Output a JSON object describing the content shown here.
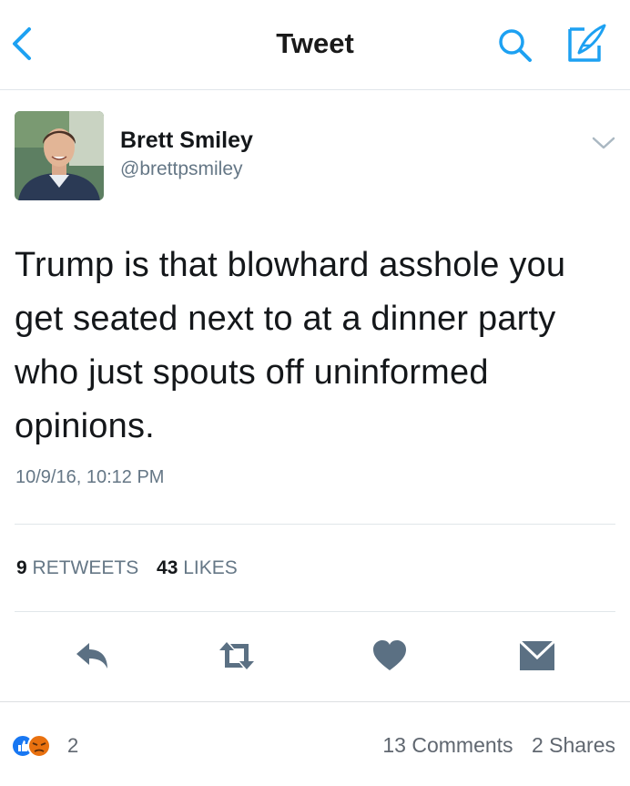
{
  "header": {
    "title": "Tweet"
  },
  "tweet": {
    "author_name": "Brett Smiley",
    "author_handle": "@brettpsmiley",
    "text": "Trump is that blowhard asshole you get seated next to at a dinner party who just spouts off uninformed opinions.",
    "timestamp": "10/9/16, 10:12 PM",
    "retweets_count": "9",
    "retweets_label": "RETWEETS",
    "likes_count": "43",
    "likes_label": "LIKES"
  },
  "colors": {
    "accent": "#1da1f2",
    "icon_gray": "#657786",
    "action_gray": "#5b7083"
  },
  "icons": [
    "back-icon",
    "search-icon",
    "compose-icon",
    "chevron-down-icon",
    "reply-icon",
    "retweet-icon",
    "like-icon",
    "message-icon",
    "like-reaction-icon",
    "angry-reaction-icon"
  ],
  "facebook": {
    "reactions_count": "2",
    "comments": "13 Comments",
    "shares": "2 Shares"
  }
}
